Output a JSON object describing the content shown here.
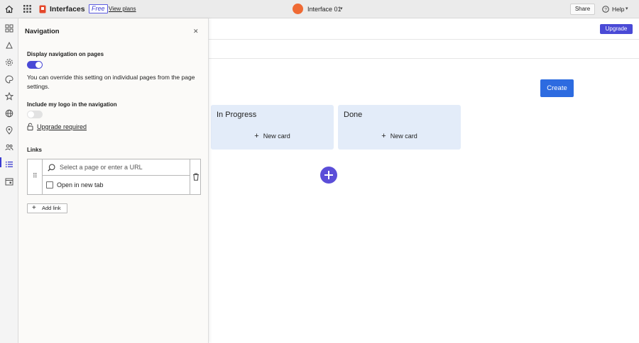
{
  "topbar": {
    "brand": "Interfaces",
    "plan_badge": "Free",
    "view_plans": "View plans",
    "interface_name": "Interface 01",
    "share": "Share",
    "help": "Help"
  },
  "background": {
    "upgrade": "Upgrade",
    "create": "Create",
    "columns": [
      {
        "title": "In Progress",
        "new_card": "New card"
      },
      {
        "title": "Done",
        "new_card": "New card"
      }
    ]
  },
  "nav_panel": {
    "title": "Navigation",
    "display_nav_label": "Display navigation on pages",
    "display_nav_on": true,
    "override_text": "You can override this setting on individual pages from the page settings.",
    "include_logo_label": "Include my logo in the navigation",
    "include_logo_on": false,
    "upgrade_required": "Upgrade required",
    "links_label": "Links",
    "url_placeholder": "Select a page or enter a URL",
    "open_new_tab": "Open in new tab",
    "add_link": "Add link"
  },
  "colors": {
    "accent": "#4a4ad6",
    "create_button": "#2d6be0",
    "column_bg": "#e3ecf9"
  }
}
